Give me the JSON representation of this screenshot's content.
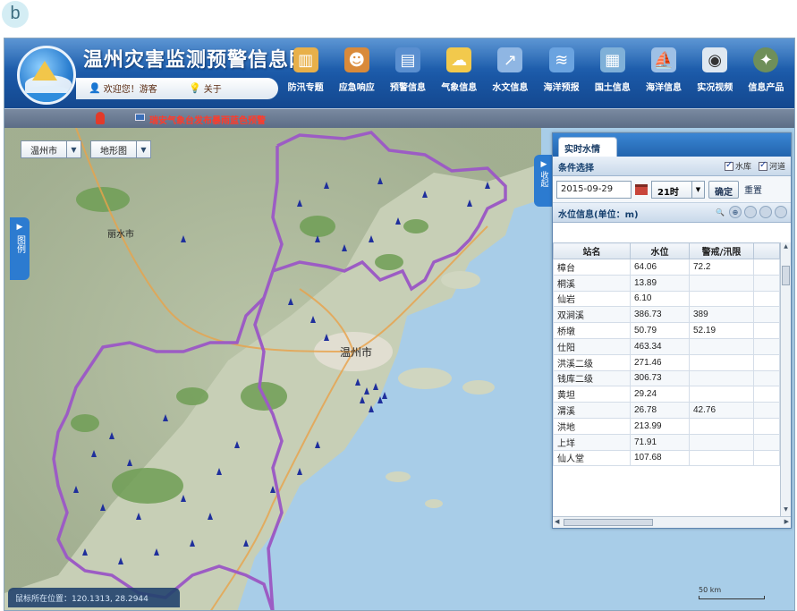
{
  "figure_label": "b",
  "header": {
    "site_title": "温州灾害监测预警信息网",
    "welcome": "欢迎您！游客",
    "about": "关于"
  },
  "menu": [
    {
      "label": "防汛专题",
      "icon": "book-icon",
      "color": "#e8b04a"
    },
    {
      "label": "应急响应",
      "icon": "person-icon",
      "color": "#d98a3a"
    },
    {
      "label": "预警信息",
      "icon": "document-icon",
      "color": "#5a8fd0"
    },
    {
      "label": "气象信息",
      "icon": "weather-icon",
      "color": "#f2c94c"
    },
    {
      "label": "水文信息",
      "icon": "chart-icon",
      "color": "#8fb6e3"
    },
    {
      "label": "海洋预报",
      "icon": "ocean-icon",
      "color": "#6aa3e0"
    },
    {
      "label": "国土信息",
      "icon": "map-icon",
      "color": "#7fb0d8"
    },
    {
      "label": "海洋信息",
      "icon": "sail-icon",
      "color": "#9ec0e6"
    },
    {
      "label": "实况视频",
      "icon": "camera-icon",
      "color": "#dfe8f1"
    },
    {
      "label": "信息产品",
      "icon": "compass-icon",
      "color": "#6f8f5a"
    }
  ],
  "alert": {
    "text": "瑞安气象台发布暴雨蓝色预警"
  },
  "map_controls": {
    "city_select": "温州市",
    "layer_select": "地形图",
    "side_tab": "图例",
    "city_label": "温州市",
    "other_city_label": "丽水市",
    "coordinates": "鼠标所在位置：120.1313, 28.2944",
    "scale": "50 km"
  },
  "panel": {
    "tab": "实时水情",
    "collapse_label": "收起",
    "condition_title": "条件选择",
    "checks": [
      "水库",
      "河道"
    ],
    "date_value": "2015-09-29",
    "hour_value": "21时",
    "confirm_button": "确定",
    "reset_button": "重置",
    "water_title": "水位信息(单位：m)",
    "columns": [
      "站名",
      "水位",
      "警戒/汛限"
    ],
    "rows": [
      [
        "樟台",
        "64.06",
        "72.2"
      ],
      [
        "桐溪",
        "13.89",
        ""
      ],
      [
        "仙岩",
        "6.10",
        ""
      ],
      [
        "双涧溪",
        "386.73",
        "389"
      ],
      [
        "桥墩",
        "50.79",
        "52.19"
      ],
      [
        "仕阳",
        "463.34",
        ""
      ],
      [
        "洪溪二级",
        "271.46",
        ""
      ],
      [
        "钱库二级",
        "306.73",
        ""
      ],
      [
        "黄坦",
        "29.24",
        ""
      ],
      [
        "渭溪",
        "26.78",
        "42.76"
      ],
      [
        "洪地",
        "213.99",
        ""
      ],
      [
        "上垟",
        "71.91",
        ""
      ],
      [
        "仙人堂",
        "107.68",
        ""
      ]
    ]
  },
  "colors": {
    "header_blue": "#1a57a5",
    "boundary_purple": "#9c5cc4",
    "station_marker": "#1f2f9c",
    "alert_red": "#ff3b2a"
  }
}
